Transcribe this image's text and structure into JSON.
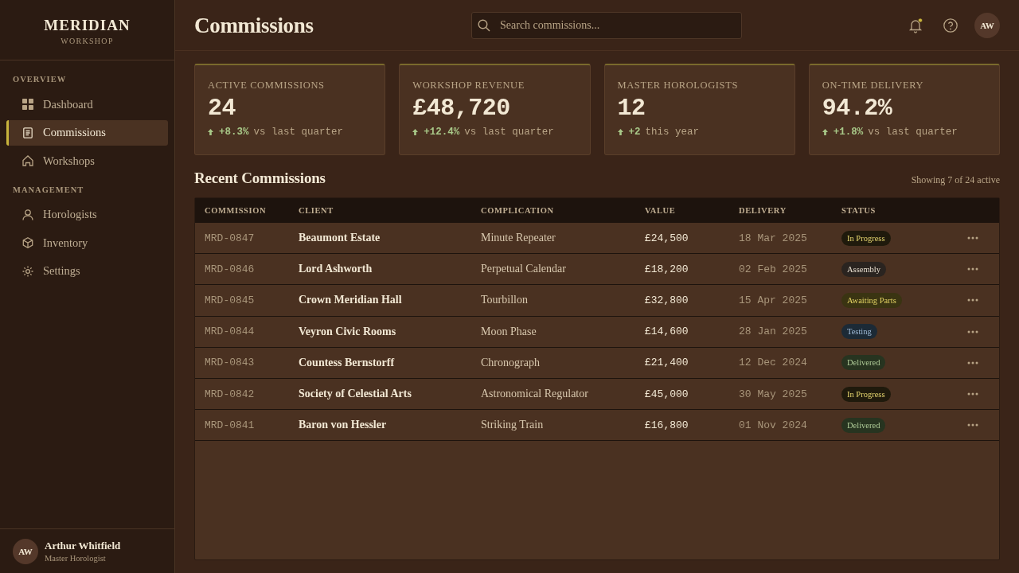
{
  "sidebar": {
    "brand": {
      "name": "MERIDIAN",
      "tagline": "WORKSHOP"
    },
    "sections": [
      {
        "label": "OVERVIEW",
        "items": [
          {
            "label": "Dashboard",
            "selected": false
          },
          {
            "label": "Commissions",
            "selected": true
          },
          {
            "label": "Workshops",
            "selected": false
          }
        ]
      },
      {
        "label": "MANAGEMENT",
        "items": [
          {
            "label": "Horologists",
            "selected": false
          },
          {
            "label": "Inventory",
            "selected": false
          },
          {
            "label": "Settings",
            "selected": false
          }
        ]
      }
    ],
    "user": {
      "initials": "AW",
      "name": "Arthur Whitfield",
      "role": "Master Horologist"
    }
  },
  "header": {
    "title": "Commissions",
    "search": {
      "placeholder": "Search commissions..."
    },
    "notifications_unread": true,
    "user_initials": "AW"
  },
  "stats": [
    {
      "label": "ACTIVE COMMISSIONS",
      "value": "24",
      "rising": true,
      "change": "+8.3%",
      "note": "vs last quarter"
    },
    {
      "label": "WORKSHOP REVENUE",
      "value": "£48,720",
      "rising": true,
      "change": "+12.4%",
      "note": "vs last quarter"
    },
    {
      "label": "MASTER HOROLOGISTS",
      "value": "12",
      "rising": true,
      "change": "+2",
      "note": "this year"
    },
    {
      "label": "ON-TIME DELIVERY",
      "value": "94.2%",
      "rising": true,
      "change": "+1.8%",
      "note": "vs last quarter"
    }
  ],
  "recent": {
    "title": "Recent Commissions",
    "summary": "Showing 7 of 24 active",
    "table": {
      "columns": [
        "COMMISSION",
        "CLIENT",
        "COMPLICATION",
        "VALUE",
        "DELIVERY",
        "STATUS"
      ],
      "rows": [
        {
          "commission": "MRD-0847",
          "client": "Beaumont Estate",
          "complication": "Minute Repeater",
          "value": "£24,500",
          "delivery": "18 Mar 2025",
          "status": {
            "label": "In Progress",
            "kind": "progress"
          }
        },
        {
          "commission": "MRD-0846",
          "client": "Lord Ashworth",
          "complication": "Perpetual Calendar",
          "value": "£18,200",
          "delivery": "02 Feb 2025",
          "status": {
            "label": "Assembly",
            "kind": "assembly"
          }
        },
        {
          "commission": "MRD-0845",
          "client": "Crown Meridian Hall",
          "complication": "Tourbillon",
          "value": "£32,800",
          "delivery": "15 Apr 2025",
          "status": {
            "label": "Awaiting Parts",
            "kind": "awaiting"
          }
        },
        {
          "commission": "MRD-0844",
          "client": "Veyron Civic Rooms",
          "complication": "Moon Phase",
          "value": "£14,600",
          "delivery": "28 Jan 2025",
          "status": {
            "label": "Testing",
            "kind": "testing"
          }
        },
        {
          "commission": "MRD-0843",
          "client": "Countess Bernstorff",
          "complication": "Chronograph",
          "value": "£21,400",
          "delivery": "12 Dec 2024",
          "status": {
            "label": "Delivered",
            "kind": "delivered"
          }
        },
        {
          "commission": "MRD-0842",
          "client": "Society of Celestial Arts",
          "complication": "Astronomical Regulator",
          "value": "£45,000",
          "delivery": "30 May 2025",
          "status": {
            "label": "In Progress",
            "kind": "progress"
          }
        },
        {
          "commission": "MRD-0841",
          "client": "Baron von Hessler",
          "complication": "Striking Train",
          "value": "£16,800",
          "delivery": "01 Nov 2024",
          "status": {
            "label": "Delivered",
            "kind": "delivered"
          }
        }
      ]
    }
  }
}
